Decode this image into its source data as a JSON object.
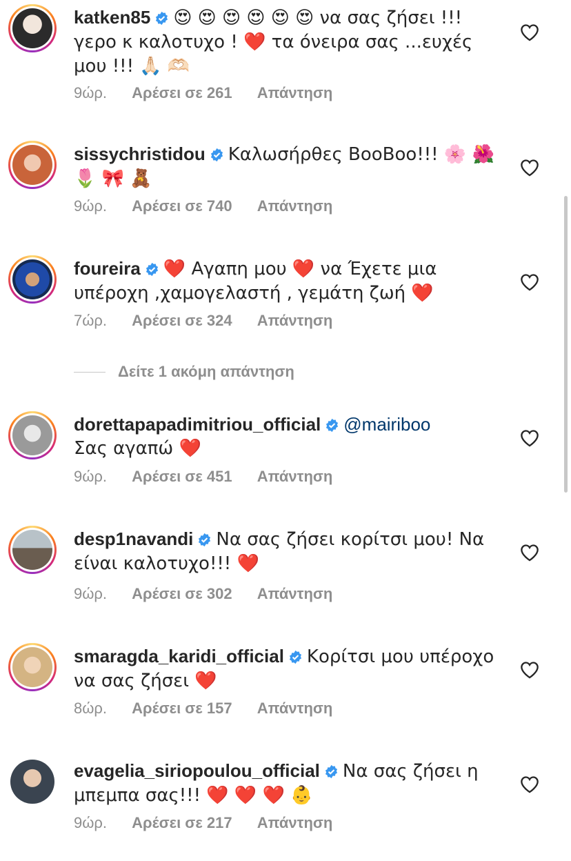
{
  "comments": [
    {
      "username": "katken85",
      "verified": true,
      "mention": "",
      "text": "😍 😍 😍 😍 😍 😍 να σας ζήσει !!! γερο κ καλοτυχο ! ❤️ τα όνειρα σας ...ευχές μου !!! 🙏🏻 🫶🏻",
      "time": "9ώρ.",
      "likes": "Αρέσει σε 261",
      "reply": "Απάντηση",
      "avatar_color": "#d9c6b8"
    },
    {
      "username": "sissychristidou",
      "verified": true,
      "mention": "",
      "text": "Καλωσήρθες BooBoo!!! 🌸 🌺 🌷 🎀 🧸",
      "time": "9ώρ.",
      "likes": "Αρέσει σε 740",
      "reply": "Απάντηση",
      "avatar_color": "#c9643a"
    },
    {
      "username": "foureira",
      "verified": true,
      "mention": "",
      "text": "❤️  Αγαπη μου ❤️ να Έχετε μια υπέροχη ,χαμογελαστή , γεμάτη ζωή ❤️",
      "time": "7ώρ.",
      "likes": "Αρέσει σε 324",
      "reply": "Απάντηση",
      "avatar_color": "#1f4aa8"
    },
    {
      "username": "dorettapapadimitriou_official",
      "verified": true,
      "mention": "@mairiboo",
      "text": "Σας αγαπώ ❤️",
      "time": "9ώρ.",
      "likes": "Αρέσει σε 451",
      "reply": "Απάντηση",
      "avatar_color": "#b8b8b8"
    },
    {
      "username": "desp1navandi",
      "verified": true,
      "mention": "",
      "text": "Να σας ζήσει κορίτσι μου! Να είναι καλοτυχο!!! ❤️",
      "time": "9ώρ.",
      "likes": "Αρέσει σε 302",
      "reply": "Απάντηση",
      "avatar_color": "#8a7a6a"
    },
    {
      "username": "smaragda_karidi_official",
      "verified": true,
      "mention": "",
      "text": "Κορίτσι μου υπέροχο να σας ζήσει ❤️",
      "time": "8ώρ.",
      "likes": "Αρέσει σε 157",
      "reply": "Απάντηση",
      "avatar_color": "#d4b483"
    },
    {
      "username": "evagelia_siriopoulou_official",
      "verified": true,
      "mention": "",
      "text": "Να σας ζήσει η μπεμπα σας!!! ❤️ ❤️ ❤️ 👶",
      "time": "9ώρ.",
      "likes": "Αρέσει σε 217",
      "reply": "Απάντηση",
      "avatar_color": "#3a4450"
    }
  ],
  "view_more": "Δείτε 1 ακόμη απάντηση",
  "colors": {
    "verified": "#3897f0",
    "heart_outline": "#262626",
    "meta": "#8e8e8e"
  }
}
